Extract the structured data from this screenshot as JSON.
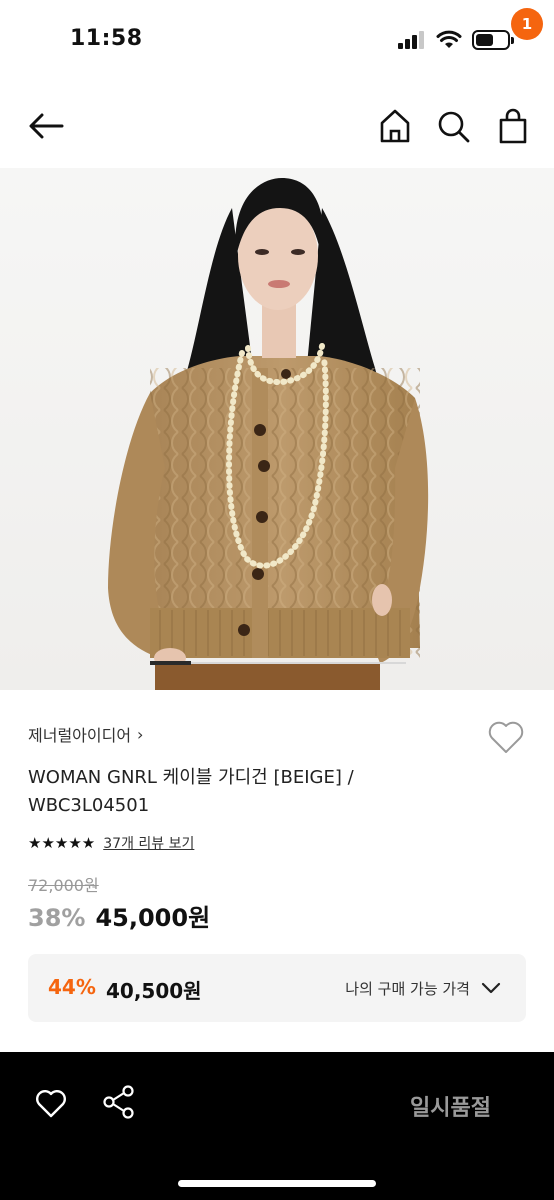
{
  "status_bar": {
    "time": "11:58",
    "icons": [
      "signal-icon",
      "wifi-icon",
      "battery-icon"
    ],
    "battery_level": 0.55
  },
  "nav": {
    "icons": [
      "back-arrow-icon",
      "home-icon",
      "search-icon",
      "shopping-bag-icon"
    ],
    "cart_count": "1",
    "badge_color": "#f5650f"
  },
  "product": {
    "image_alt": "beige cable-knit cardigan",
    "carousel_progress": 0.16,
    "brand": "제너럴아이디어",
    "brand_chevron": "›",
    "name": "WOMAN GNRL 케이블 가디건 [BEIGE] / WBC3L04501",
    "rating": 5,
    "stars": "★★★★★",
    "review_link": "37개 리뷰 보기",
    "original_price": "72,000원",
    "discount_rate": "38%",
    "sale_price": "45,000원"
  },
  "member_price": {
    "discount_rate": "44%",
    "price": "40,500원",
    "label": "나의 구매 가능 가격",
    "accent": "#f5650f"
  },
  "bottom_bar": {
    "icons": [
      "heart-icon",
      "share-icon"
    ],
    "status_label": "일시품절"
  }
}
